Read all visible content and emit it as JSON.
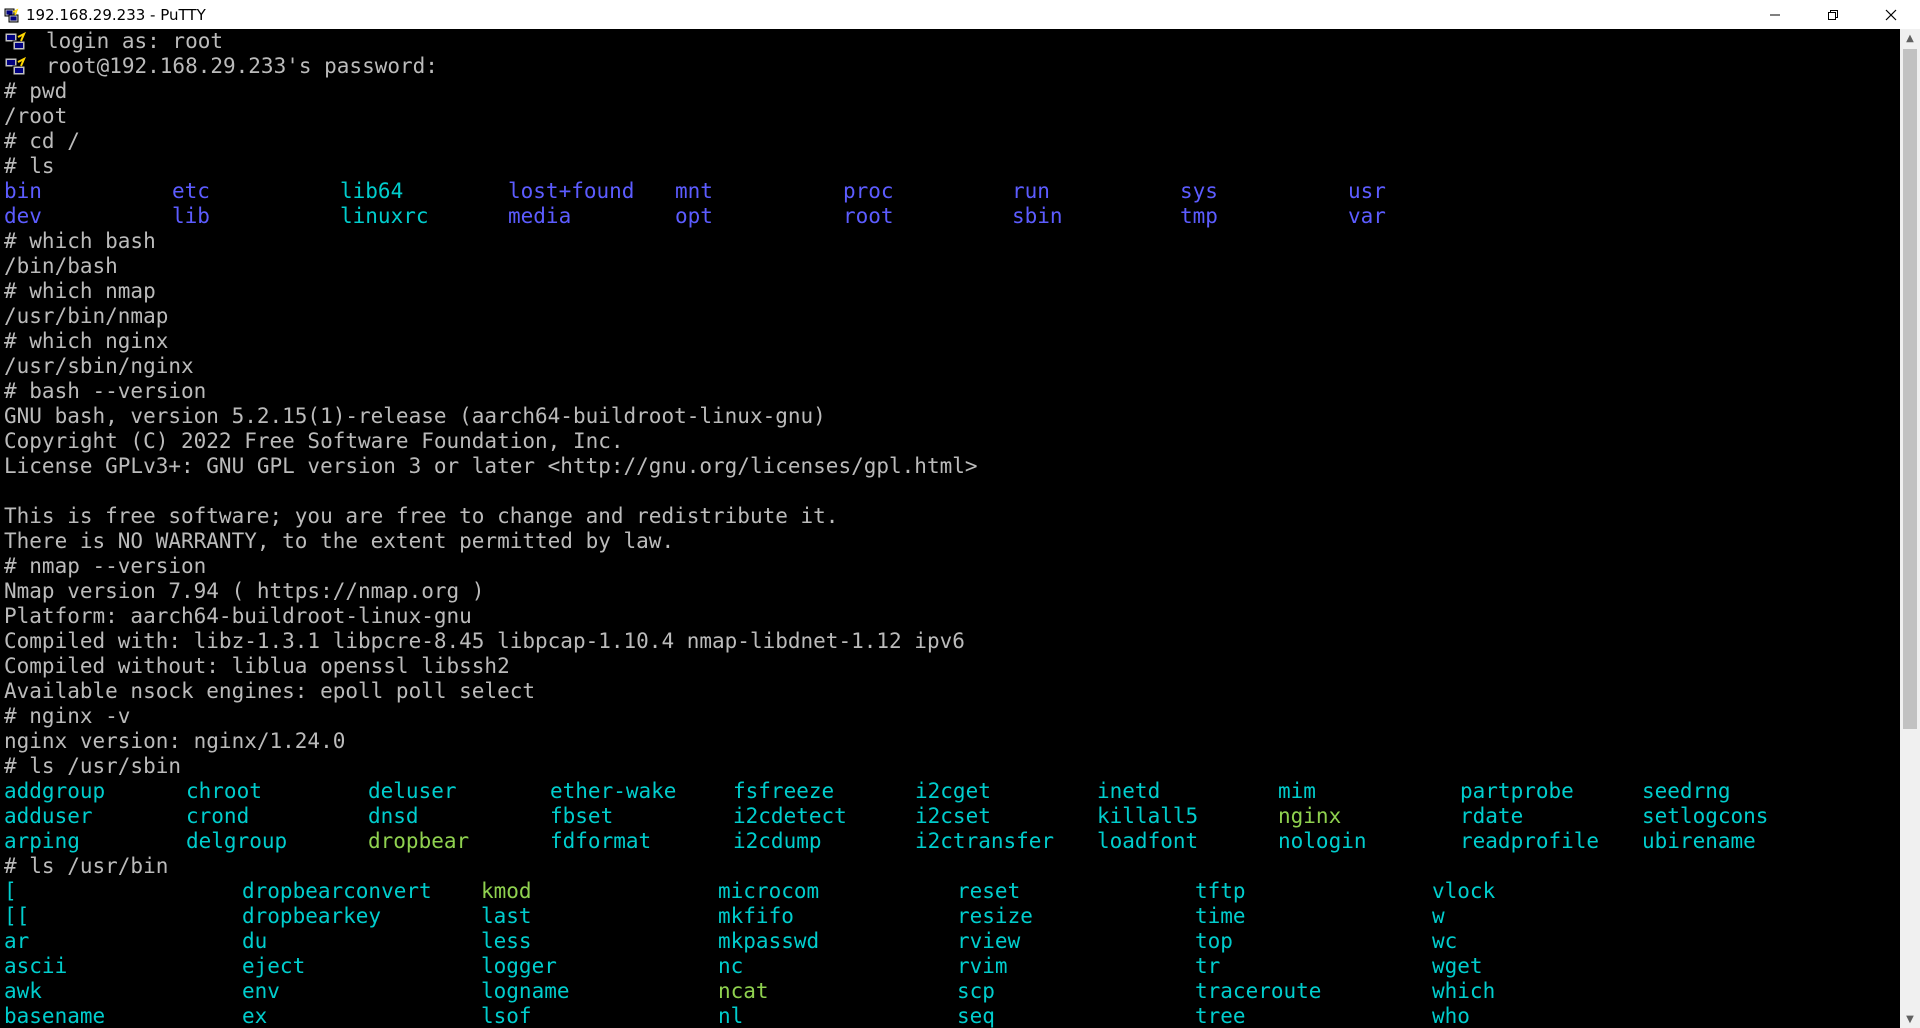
{
  "window": {
    "title": "192.168.29.233 - PuTTY",
    "controls": [
      "minimize",
      "restore",
      "close"
    ]
  },
  "colors": {
    "plain": "#bbbbbb",
    "directory": "#5c5cff",
    "symlink": "#00cdcd",
    "executable": "#8fd14f"
  },
  "terminal": {
    "login_lines": [
      "login as: root",
      "root@192.168.29.233's password:"
    ],
    "lines": [
      "# pwd",
      "/root",
      "# cd /",
      "# ls"
    ],
    "ls_root": [
      [
        "bin",
        "etc",
        "lib64",
        "lost+found",
        "mnt",
        "proc",
        "run",
        "sys",
        "usr"
      ],
      [
        "dev",
        "lib",
        "linuxrc",
        "media",
        "opt",
        "root",
        "sbin",
        "tmp",
        "var"
      ]
    ],
    "ls_root_types": [
      [
        "d",
        "d",
        "l",
        "d",
        "d",
        "d",
        "d",
        "d",
        "d"
      ],
      [
        "d",
        "d",
        "l",
        "d",
        "d",
        "d",
        "d",
        "d",
        "d"
      ]
    ],
    "lines2": [
      "# which bash",
      "/bin/bash",
      "# which nmap",
      "/usr/bin/nmap",
      "# which nginx",
      "/usr/sbin/nginx",
      "# bash --version",
      "GNU bash, version 5.2.15(1)-release (aarch64-buildroot-linux-gnu)",
      "Copyright (C) 2022 Free Software Foundation, Inc.",
      "License GPLv3+: GNU GPL version 3 or later <http://gnu.org/licenses/gpl.html>",
      "",
      "This is free software; you are free to change and redistribute it.",
      "There is NO WARRANTY, to the extent permitted by law.",
      "# nmap --version",
      "Nmap version 7.94 ( https://nmap.org )",
      "Platform: aarch64-buildroot-linux-gnu",
      "Compiled with: libz-1.3.1 libpcre-8.45 libpcap-1.10.4 nmap-libdnet-1.12 ipv6",
      "Compiled without: liblua openssl libssh2",
      "Available nsock engines: epoll poll select",
      "# nginx -v",
      "nginx version: nginx/1.24.0",
      "# ls /usr/sbin"
    ],
    "ls_usr_sbin": [
      [
        "addgroup",
        "chroot",
        "deluser",
        "ether-wake",
        "fsfreeze",
        "i2cget",
        "inetd",
        "mim",
        "partprobe",
        "seedrng"
      ],
      [
        "adduser",
        "crond",
        "dnsd",
        "fbset",
        "i2cdetect",
        "i2cset",
        "killall5",
        "nginx",
        "rdate",
        "setlogcons"
      ],
      [
        "arping",
        "delgroup",
        "dropbear",
        "fdformat",
        "i2cdump",
        "i2ctransfer",
        "loadfont",
        "nologin",
        "readprofile",
        "ubirename"
      ]
    ],
    "ls_usr_sbin_types": [
      [
        "l",
        "l",
        "l",
        "l",
        "l",
        "l",
        "l",
        "l",
        "l",
        "l"
      ],
      [
        "l",
        "l",
        "l",
        "l",
        "l",
        "l",
        "l",
        "x",
        "l",
        "l"
      ],
      [
        "l",
        "l",
        "x",
        "l",
        "l",
        "l",
        "l",
        "l",
        "l",
        "l"
      ]
    ],
    "ls_usr_bin_cmd": "# ls /usr/bin",
    "ls_usr_bin": [
      [
        "[",
        "dropbearconvert",
        "kmod",
        "microcom",
        "reset",
        "tftp",
        "vlock"
      ],
      [
        "[[",
        "dropbearkey",
        "last",
        "mkfifo",
        "resize",
        "time",
        "w"
      ],
      [
        "ar",
        "du",
        "less",
        "mkpasswd",
        "rview",
        "top",
        "wc"
      ],
      [
        "ascii",
        "eject",
        "logger",
        "nc",
        "rvim",
        "tr",
        "wget"
      ],
      [
        "awk",
        "env",
        "logname",
        "ncat",
        "scp",
        "traceroute",
        "which"
      ],
      [
        "basename",
        "ex",
        "lsof",
        "nl",
        "seq",
        "tree",
        "who"
      ]
    ],
    "ls_usr_bin_types": [
      [
        "l",
        "l",
        "x",
        "l",
        "l",
        "l",
        "l"
      ],
      [
        "l",
        "l",
        "l",
        "l",
        "l",
        "l",
        "l"
      ],
      [
        "l",
        "l",
        "l",
        "l",
        "l",
        "l",
        "l"
      ],
      [
        "l",
        "l",
        "l",
        "l",
        "l",
        "l",
        "l"
      ],
      [
        "l",
        "l",
        "l",
        "x",
        "l",
        "l",
        "l"
      ],
      [
        "l",
        "l",
        "l",
        "l",
        "l",
        "l",
        "l"
      ]
    ]
  }
}
